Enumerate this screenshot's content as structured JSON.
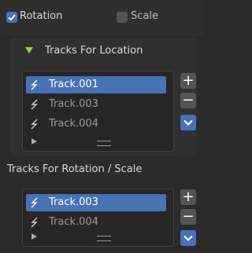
{
  "options": {
    "rotation_label": "Rotation",
    "rotation_checked": true,
    "scale_label": "Scale",
    "scale_checked": false
  },
  "location_section": {
    "title": "Tracks For Location",
    "tracks": [
      {
        "label": "Track.001",
        "selected": true
      },
      {
        "label": "Track.003",
        "selected": false
      },
      {
        "label": "Track.004",
        "selected": false
      }
    ],
    "add_label": "+",
    "remove_label": "−"
  },
  "rotation_section": {
    "title": "Tracks For Rotation / Scale",
    "tracks": [
      {
        "label": "Track.003",
        "selected": true
      },
      {
        "label": "Track.004",
        "selected": false
      }
    ],
    "add_label": "+",
    "remove_label": "−"
  },
  "colors": {
    "accent": "#4772b3",
    "background": "#2b2b2b",
    "text": "#d9d9d9",
    "dim_text": "#9a9a9a"
  }
}
